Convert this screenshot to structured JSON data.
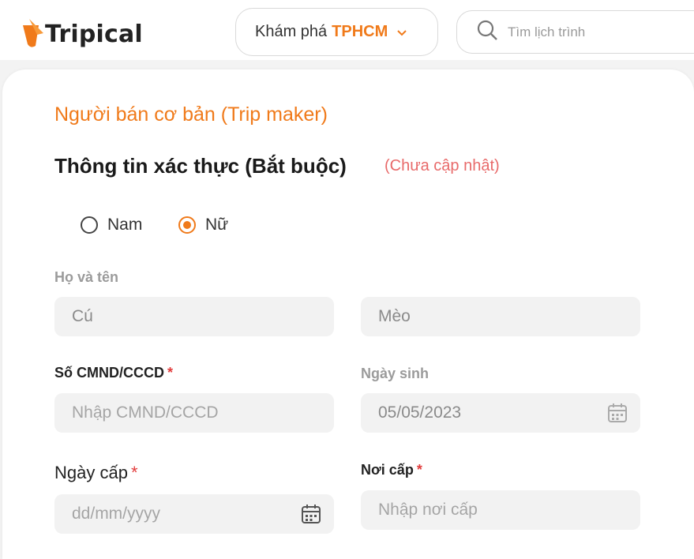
{
  "brand": {
    "name": "Tripical",
    "color": "#f07a1a"
  },
  "header": {
    "explore_label": "Khám phá",
    "explore_city": "TPHCM",
    "search_placeholder": "Tìm lịch trình"
  },
  "form": {
    "section_title": "Người bán cơ bản (Trip maker)",
    "subtitle": "Thông tin xác thực (Bắt buộc)",
    "status": "(Chưa cập nhật)",
    "gender": {
      "options": [
        "Nam",
        "Nữ"
      ],
      "selected": "Nữ"
    },
    "full_name": {
      "label": "Họ và tên",
      "first": "Cú",
      "last": "Mèo"
    },
    "id_number": {
      "label": "Số CMND/CCCD",
      "required_mark": "*",
      "placeholder": "Nhập CMND/CCCD"
    },
    "birth_date": {
      "label": "Ngày sinh",
      "value": "05/05/2023"
    },
    "issue_date": {
      "label": "Ngày cấp",
      "required_mark": "*",
      "placeholder": "dd/mm/yyyy"
    },
    "issue_place": {
      "label": "Nơi cấp",
      "required_mark": "*",
      "placeholder": "Nhập nơi cấp"
    }
  }
}
